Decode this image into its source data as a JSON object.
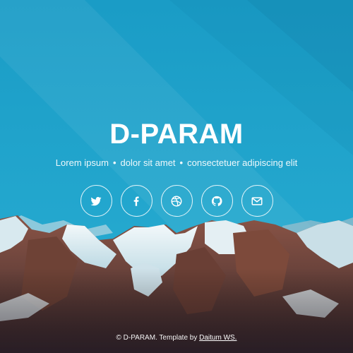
{
  "site": {
    "title": "D-PARAM",
    "tagline": {
      "part1": "Lorem ipsum",
      "part2": "dolor sit amet",
      "part3": "consectetuer adipiscing elit",
      "separator": "•"
    }
  },
  "social": [
    {
      "icon": "twitter-icon"
    },
    {
      "icon": "facebook-icon"
    },
    {
      "icon": "dribbble-icon"
    },
    {
      "icon": "github-icon"
    },
    {
      "icon": "mail-icon"
    }
  ],
  "footer": {
    "copyright": "© D-PARAM. Template by ",
    "credit_link": "Daitum WS."
  },
  "colors": {
    "sky": "#1fa0c8",
    "sky_dark": "#1592bd",
    "rock": "#7a4b3c",
    "snow": "#eaf4f7"
  }
}
